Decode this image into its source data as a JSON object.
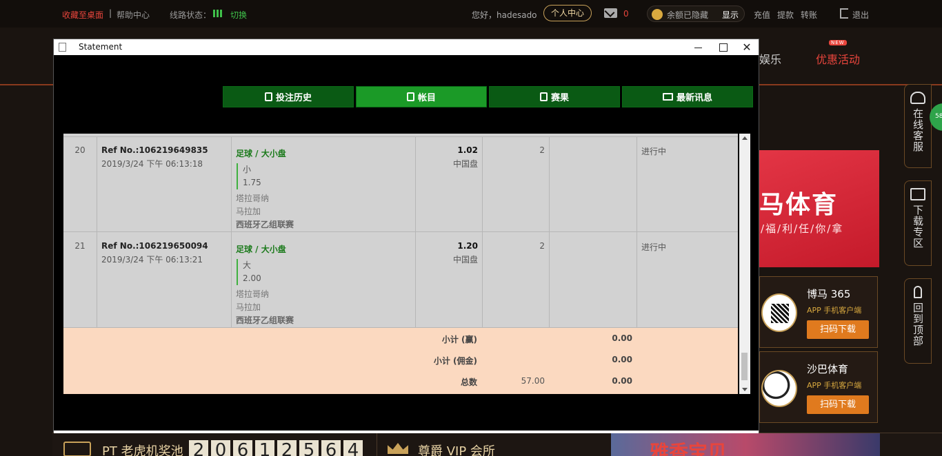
{
  "topbar": {
    "favorite": "收藏至桌面",
    "separator": "|",
    "help": "帮助中心",
    "line_status": "线路状态：",
    "switch": "切换",
    "hello": "您好，hadesado",
    "personal_center": "个人中心",
    "mail_count": "0",
    "balance_hidden": "余额已隐藏",
    "show": "显示",
    "links": [
      "充值",
      "提款",
      "转账"
    ],
    "logout": "退出"
  },
  "nav": {
    "entertainment": "娱乐",
    "promotions": "优惠活动",
    "new_badge": "NEW"
  },
  "promo_banner": {
    "headline": "马体育",
    "tagline": "/福/利/任/你/拿"
  },
  "apps": [
    {
      "name": "博马 365",
      "subtitle": "APP 手机客户端",
      "button": "扫码下载"
    },
    {
      "name": "沙巴体育",
      "subtitle": "APP 手机客户端",
      "button": "扫码下载"
    }
  ],
  "side_tabs": [
    {
      "label": "在线客服"
    },
    {
      "label": "下载专区"
    },
    {
      "label": "回到顶部"
    }
  ],
  "online_badge": "58",
  "bottom": {
    "pt_label": "PT 老虎机奖池",
    "jackpot_digits": [
      "2",
      "0",
      "6",
      "1",
      "2",
      "5",
      "6",
      "4"
    ],
    "vip_label": "尊爵 VIP 会所",
    "banner_text": "雅香宝贝"
  },
  "window": {
    "title": "Statement",
    "minimize": "",
    "maximize": "",
    "close": "✕"
  },
  "tabs": [
    {
      "label": "投注历史",
      "active": false
    },
    {
      "label": "帐目",
      "active": true
    },
    {
      "label": "赛果",
      "active": false
    },
    {
      "label": "最新讯息",
      "active": false
    }
  ],
  "rows": [
    {
      "index": "20",
      "ref": "Ref No.:106219649835",
      "time": "2019/3/24 下午 06:13:18",
      "sport": "足球 / 大小盘",
      "pick": "小",
      "pick_odds": "1.75",
      "home": "塔拉哥纳",
      "away": "马拉加",
      "league": "西班牙乙组联赛",
      "odds": "1.02",
      "odds_type": "中国盘",
      "stake": "2",
      "status": "进行中"
    },
    {
      "index": "21",
      "ref": "Ref No.:106219650094",
      "time": "2019/3/24 下午 06:13:21",
      "sport": "足球 / 大小盘",
      "pick": "大",
      "pick_odds": "2.00",
      "home": "塔拉哥纳",
      "away": "马拉加",
      "league": "西班牙乙组联赛",
      "odds": "1.20",
      "odds_type": "中国盘",
      "stake": "2",
      "status": "进行中"
    }
  ],
  "summary": {
    "subtotal_win_label": "小计 (赢)",
    "subtotal_win": "0.00",
    "subtotal_comm_label": "小计 (佣金)",
    "subtotal_comm": "0.00",
    "total_label": "总数",
    "total_stake": "57.00",
    "total": "0.00"
  }
}
